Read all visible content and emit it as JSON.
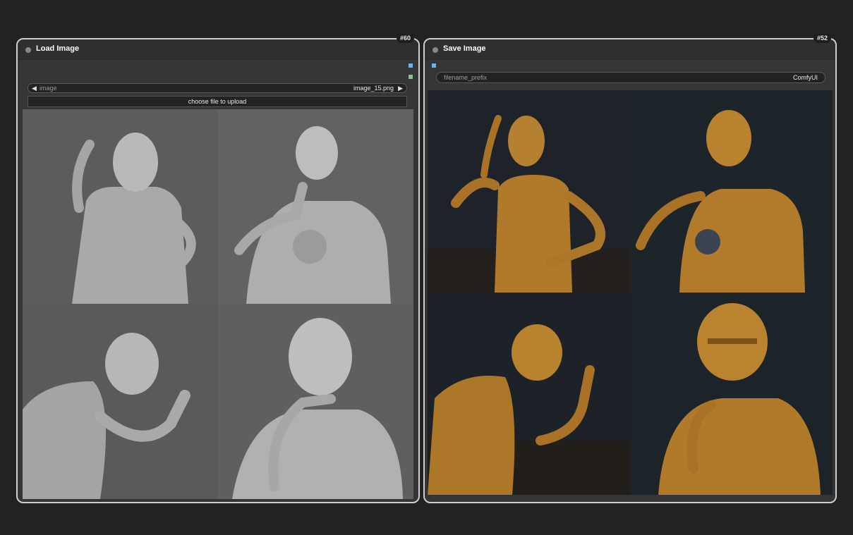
{
  "load_node": {
    "id_badge": "#60",
    "title": "Load Image",
    "image_widget": {
      "label": "image",
      "value": "image_15.png"
    },
    "upload_label": "choose file to upload"
  },
  "save_node": {
    "id_badge": "#52",
    "title": "Save Image",
    "filename_widget": {
      "label": "filename_prefix",
      "value": "ComfyUI"
    }
  },
  "colors": {
    "canvas_bg": "#222222",
    "node_body": "#353535",
    "node_border": "#cfcfcf",
    "image_slot": "#64b5f6",
    "mask_slot": "#81c784",
    "mannequin": "#b9b9b9",
    "robot": "#b07a2a"
  },
  "icons": {
    "left_arrow": "left-arrow-icon",
    "right_arrow": "right-arrow-icon"
  }
}
